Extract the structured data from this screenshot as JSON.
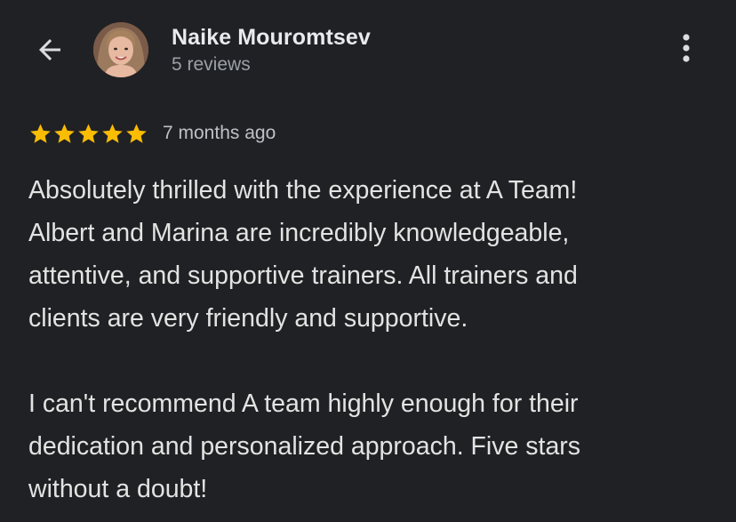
{
  "header": {
    "back_icon": "arrow-left-icon",
    "reviewer_name": "Naike Mouromtsev",
    "review_count": "5 reviews",
    "more_icon": "more-vert-icon"
  },
  "review": {
    "rating": 5,
    "rating_max": 5,
    "star_color": "#fbbc04",
    "date": "7 months ago",
    "paragraphs": [
      "Absolutely thrilled with the experience at A Team!\nAlbert and Marina are incredibly knowledgeable,\nattentive, and supportive trainers. All trainers and\nclients are very friendly and supportive.",
      "I can't recommend A team highly enough for their\ndedication and personalized approach. Five stars\nwithout a doubt!"
    ]
  },
  "colors": {
    "background": "#202124",
    "primary_text": "#e8eaed",
    "secondary_text": "#9aa0a6"
  }
}
